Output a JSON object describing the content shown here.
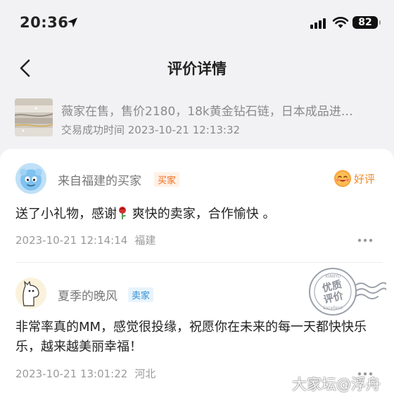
{
  "status_bar": {
    "time": "20:36",
    "battery": "82"
  },
  "nav": {
    "title": "评价详情"
  },
  "product": {
    "title": "薇家在售，售价2180，18k黄金钻石链，日本成品进…",
    "trade_time": "交易成功时间 2023-10-21 12:13:32"
  },
  "reviews": [
    {
      "user": "来自福建的买家",
      "role": "买家",
      "rating": "好评",
      "content_before": "送了小礼物，感谢",
      "content_after": " 爽快的卖家，合作愉快 。",
      "time": "2023-10-21 12:14:14",
      "location": "福建"
    },
    {
      "user": "夏季的晚风",
      "role": "卖家",
      "content": "非常率真的MM，感觉很投缘，祝愿你在未来的每一天都快快乐乐，越来越美丽幸福！",
      "time": "2023-10-21 13:01:22",
      "location": "河北"
    }
  ],
  "stamp": {
    "line1": "优质",
    "line2": "评价",
    "small_top": "XIANYU",
    "small_bottom": "Excellent"
  },
  "watermark": "大家坛@浮舟",
  "colors": {
    "accent_orange": "#f06a1a",
    "seller_blue": "#2e8fd6",
    "rating_orange": "#f08a2a"
  }
}
